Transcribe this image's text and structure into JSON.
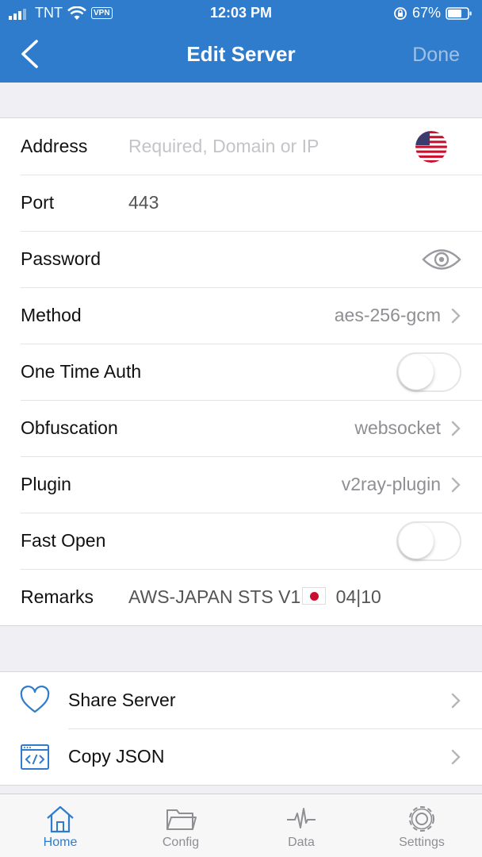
{
  "status_bar": {
    "carrier": "TNT",
    "vpn": "VPN",
    "time": "12:03 PM",
    "battery": "67%"
  },
  "nav": {
    "title": "Edit Server",
    "done_label": "Done"
  },
  "form": {
    "address": {
      "label": "Address",
      "placeholder": "Required, Domain or IP",
      "value": ""
    },
    "port": {
      "label": "Port",
      "value": "443"
    },
    "password": {
      "label": "Password"
    },
    "method": {
      "label": "Method",
      "value": "aes-256-gcm"
    },
    "one_time_auth": {
      "label": "One Time Auth",
      "enabled": false
    },
    "obfuscation": {
      "label": "Obfuscation",
      "value": "websocket"
    },
    "plugin": {
      "label": "Plugin",
      "value": "v2ray-plugin"
    },
    "fast_open": {
      "label": "Fast Open",
      "enabled": false
    },
    "remarks": {
      "label": "Remarks",
      "value_prefix": "AWS-JAPAN STS V1",
      "value_suffix": "04|10"
    }
  },
  "actions": {
    "share": {
      "label": "Share Server",
      "icon": "heart-icon"
    },
    "copy_json": {
      "label": "Copy JSON",
      "icon": "code-icon"
    }
  },
  "tabs": [
    {
      "label": "Home",
      "icon": "home-icon",
      "active": true
    },
    {
      "label": "Config",
      "icon": "folder-icon",
      "active": false
    },
    {
      "label": "Data",
      "icon": "pulse-icon",
      "active": false
    },
    {
      "label": "Settings",
      "icon": "gear-icon",
      "active": false
    }
  ],
  "colors": {
    "accent": "#2f7ccc",
    "header_bg": "#2f7ccc",
    "page_bg": "#efeff4",
    "done_disabled": "#9fc1e6"
  }
}
